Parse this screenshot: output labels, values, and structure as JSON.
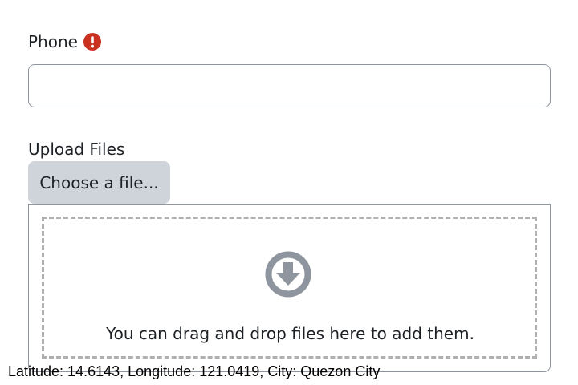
{
  "form": {
    "phone": {
      "label": "Phone",
      "value": "",
      "required_icon": "exclamation-circle-icon",
      "required_color": "#ca3120"
    },
    "upload": {
      "label": "Upload Files",
      "choose_button_label": "Choose a file...",
      "drop_icon": "arrow-circle-down-icon",
      "drop_text": "You can drag and drop files here to add them."
    }
  },
  "location": {
    "text": "Latitude: 14.6143, Longitude: 121.0419, City: Quezon City"
  },
  "colors": {
    "text": "#1d2125",
    "border": "#8f959e",
    "button_bg": "#ced4da",
    "dashed_border": "#b0b0b0",
    "icon_gray": "#8f959e"
  }
}
